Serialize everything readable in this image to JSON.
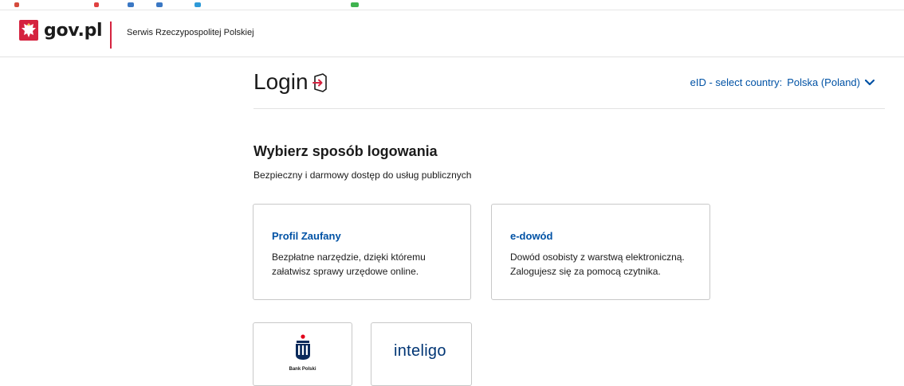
{
  "header": {
    "logo_text": "gov.pl",
    "service_name": "Serwis Rzeczypospolitej Polskiej"
  },
  "login": {
    "title": "Login",
    "country_label": "eID - select country:",
    "country_value": "Polska (Poland)"
  },
  "section": {
    "title": "Wybierz sposób logowania",
    "subtitle": "Bezpieczny i darmowy dostęp do usług publicznych"
  },
  "methods": [
    {
      "title": "Profil Zaufany",
      "description": "Bezpłatne narzędzie, dzięki któremu załatwisz sprawy urzędowe online."
    },
    {
      "title": "e-dowód",
      "description": "Dowód osobisty z warstwą elektroniczną. Zalogujesz się za pomocą czytnika."
    }
  ],
  "banks": [
    {
      "name": "Bank Polski",
      "icon": "pko-bank-logo-icon"
    },
    {
      "name": "inteligo",
      "icon": "inteligo-logo"
    }
  ],
  "colors": {
    "link": "#0052a5",
    "brand_red": "#d5233f",
    "border": "#c8c8c8"
  }
}
